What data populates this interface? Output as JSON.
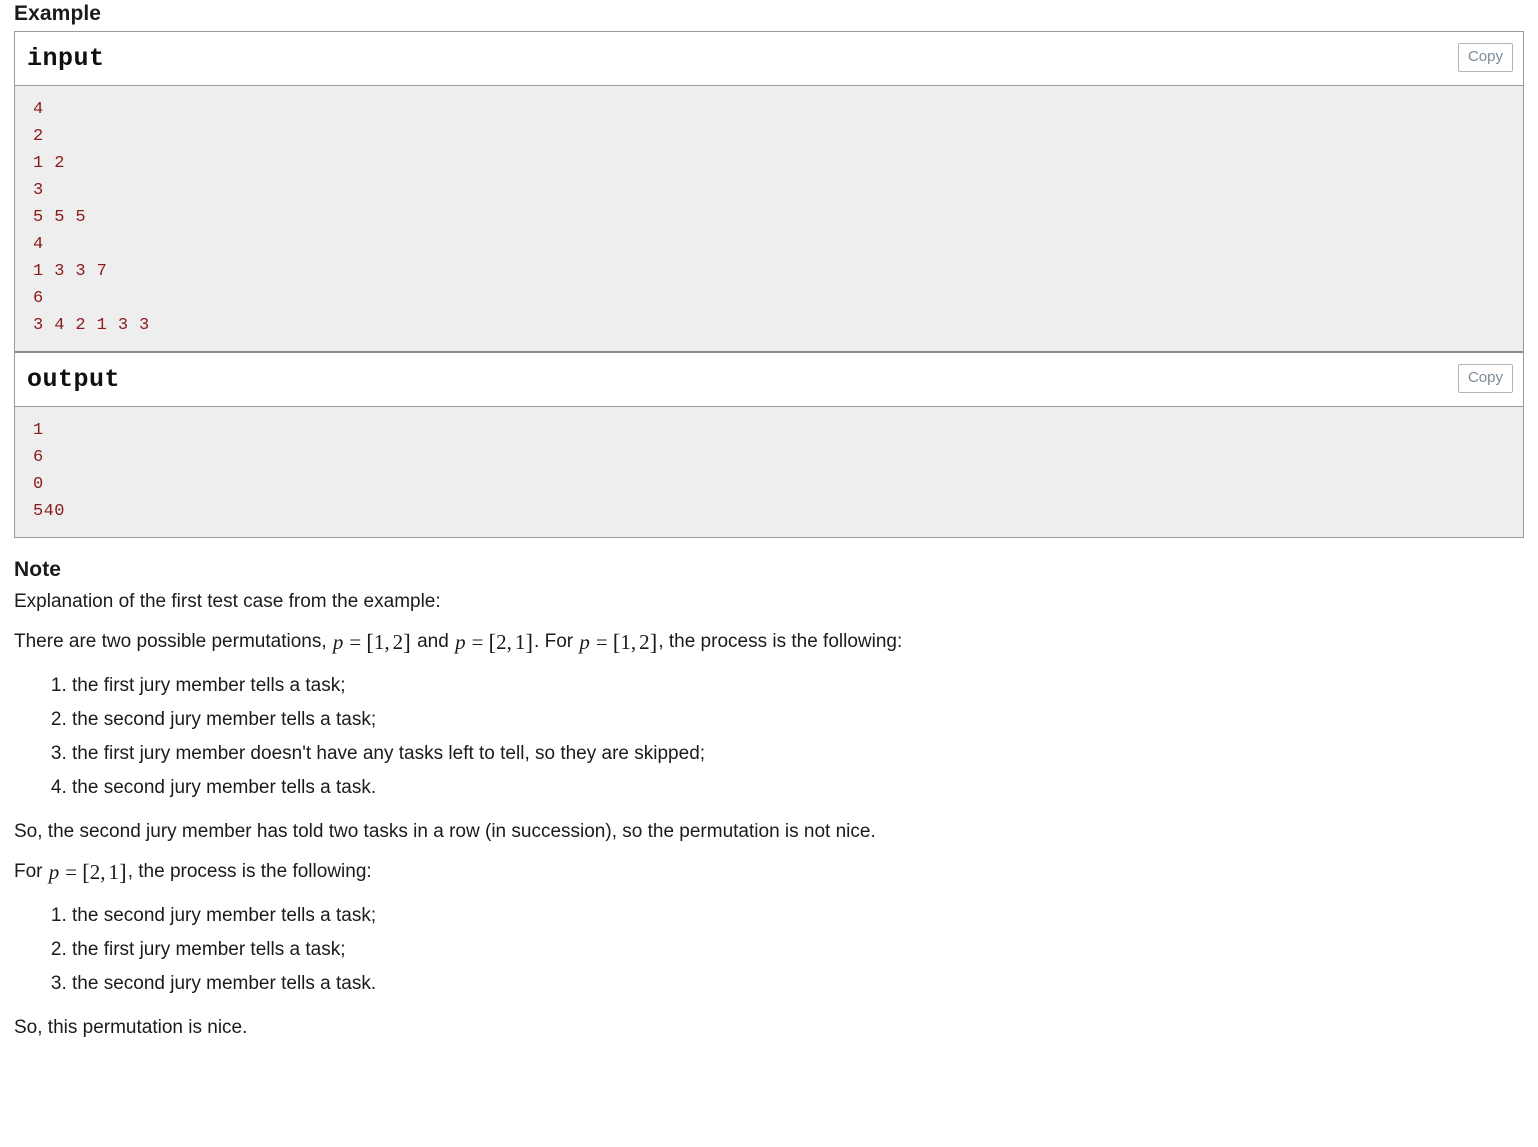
{
  "example": {
    "heading": "Example",
    "blocks": [
      {
        "title": "input",
        "copy_label": "Copy",
        "lines": [
          "4",
          "2",
          "1 2",
          "3",
          "5 5 5",
          "4",
          "1 3 3 7",
          "6",
          "3 4 2 1 3 3"
        ]
      },
      {
        "title": "output",
        "copy_label": "Copy",
        "lines": [
          "1",
          "6",
          "0",
          "540"
        ]
      }
    ]
  },
  "note": {
    "heading": "Note",
    "intro": "Explanation of the first test case from the example:",
    "para_perm": {
      "t1": "There are two possible permutations, ",
      "math1": {
        "var": "p",
        "op": "=",
        "open": "[",
        "a": "1",
        "comma": ",",
        "b": "2",
        "close": "]"
      },
      "t2": " and ",
      "math2": {
        "var": "p",
        "op": "=",
        "open": "[",
        "a": "2",
        "comma": ",",
        "b": "1",
        "close": "]"
      },
      "t3": ". For ",
      "math3": {
        "var": "p",
        "op": "=",
        "open": "[",
        "a": "1",
        "comma": ",",
        "b": "2",
        "close": "]"
      },
      "t4": ", the process is the following:"
    },
    "list1": [
      "the first jury member tells a task;",
      "the second jury member tells a task;",
      "the first jury member doesn't have any tasks left to tell, so they are skipped;",
      "the second jury member tells a task."
    ],
    "para_not_nice": "So, the second jury member has told two tasks in a row (in succession), so the permutation is not nice.",
    "para_for_p21": {
      "t1": "For ",
      "math1": {
        "var": "p",
        "op": "=",
        "open": "[",
        "a": "2",
        "comma": ",",
        "b": "1",
        "close": "]"
      },
      "t2": ", the process is the following:"
    },
    "list2": [
      "the second jury member tells a task;",
      "the first jury member tells a task;",
      "the second jury member tells a task."
    ],
    "para_nice": "So, this permutation is nice."
  },
  "colors": {
    "code_text": "#8b1a1a",
    "panel_border": "#9a9a9a",
    "code_bg": "#eeeeee",
    "copy_text": "#7b8b9a"
  }
}
